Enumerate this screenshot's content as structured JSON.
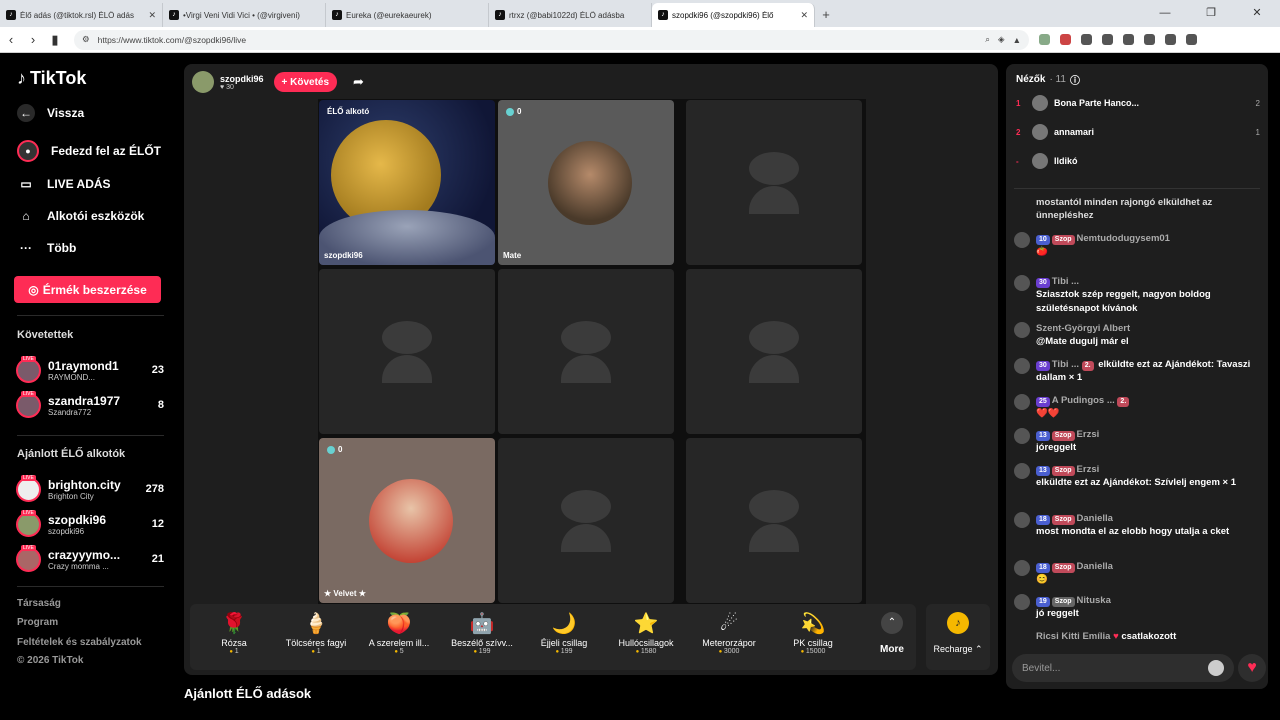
{
  "browser": {
    "tabs": [
      {
        "title": "Élő adás (@tiktok.rsl) ÉLŐ adás"
      },
      {
        "title": "•Virgi Veni Vidi Vici • (@virgiveni)"
      },
      {
        "title": "Eureka (@eurekaeurek)"
      },
      {
        "title": "rtrxz (@babi1022d) ÉLŐ adásba"
      },
      {
        "title": "szopdki96 (@szopdki96) Élő"
      }
    ],
    "url": "https://www.tiktok.com/@szopdki96/live"
  },
  "sidebar": {
    "logo": "TikTok",
    "nav": [
      {
        "label": "Vissza"
      },
      {
        "label": "Fedezd fel az ÉLŐT"
      },
      {
        "label": "LIVE ADÁS"
      },
      {
        "label": "Alkotói eszközök"
      },
      {
        "label": "Több"
      }
    ],
    "coin_button": "Érmék beszerzése",
    "following_title": "Követettek",
    "following": [
      {
        "name": "01raymond1",
        "sub": "RAYMOND...",
        "count": "23"
      },
      {
        "name": "szandra1977",
        "sub": "Szandra772",
        "count": "8"
      }
    ],
    "recommended_title": "Ajánlott ÉLŐ alkotók",
    "recommended": [
      {
        "name": "brighton.city",
        "sub": "Brighton City",
        "count": "278"
      },
      {
        "name": "szopdki96",
        "sub": "szopdki96",
        "count": "12"
      },
      {
        "name": "crazyyymo...",
        "sub": "Crazy momma ...",
        "count": "21"
      }
    ],
    "footer": [
      "Társaság",
      "Program",
      "Feltételek és szabályzatok",
      "© 2026 TikTok"
    ]
  },
  "stream": {
    "host": "szopdki96",
    "likes": "30",
    "follow": "+ Követés",
    "cells": [
      {
        "top": "ÉLŐ alkotó",
        "label": "szopdki96"
      },
      {
        "top": "0",
        "label": "Mate"
      },
      {
        "top": "0",
        "label": "★ Velvet ★"
      }
    ],
    "gifts": [
      {
        "name": "Rózsa",
        "price": "1",
        "icon": "🌹"
      },
      {
        "name": "Tölcséres fagyi",
        "price": "1",
        "icon": "🍦"
      },
      {
        "name": "A szerelem ill...",
        "price": "5",
        "icon": "🍑"
      },
      {
        "name": "Beszélő szívv...",
        "price": "199",
        "icon": "🤖"
      },
      {
        "name": "Éjjeli csillag",
        "price": "199",
        "icon": "🌙"
      },
      {
        "name": "Hullócsillagok",
        "price": "1580",
        "icon": "⭐"
      },
      {
        "name": "Meterorzápor",
        "price": "3000",
        "icon": "☄"
      },
      {
        "name": "PK csillag",
        "price": "15000",
        "icon": "💫"
      }
    ],
    "more": "More",
    "recharge": "Recharge",
    "below_title": "Ajánlott ÉLŐ adások"
  },
  "chat": {
    "title": "Nézők",
    "viewers_count": "· 11",
    "viewers": [
      {
        "rank": "1",
        "name": "Bona Parte Hanco...",
        "score": "2"
      },
      {
        "rank": "2",
        "name": "annamari",
        "score": "1"
      },
      {
        "rank": "-",
        "name": "Ildikó",
        "score": ""
      }
    ],
    "messages": [
      {
        "user": "",
        "text": "mostantól minden rajongó elküldhet az ünnepléshez",
        "lvl": "",
        "sz": ""
      },
      {
        "user": "Nemtudodugysem01",
        "text": "🍅",
        "lvl": "10",
        "sz": "Szop"
      },
      {
        "user": "Tibi ...",
        "text": "Sziasztok szép reggelt, nagyon boldog születésnapot kívánok",
        "lvl": "30",
        "sz": ""
      },
      {
        "user": "Szent-Györgyi Albert",
        "text": "@Mate dugulj már el",
        "lvl": "",
        "sz": ""
      },
      {
        "user": "Tibi ...",
        "text": "elküldte ezt az Ajándékot: Tavaszi dallam × 1",
        "lvl": "30",
        "sz": "2."
      },
      {
        "user": "A Pudingos ...",
        "text": "❤️❤️",
        "lvl": "25",
        "sz": "2."
      },
      {
        "user": "Erzsi",
        "text": "jóreggelt",
        "lvl": "13",
        "sz": "Szop"
      },
      {
        "user": "Erzsi",
        "text": "elküldte ezt az Ajándékot: Szívlelj engem × 1",
        "lvl": "13",
        "sz": "Szop"
      },
      {
        "user": "Daniella",
        "text": "most mondta el az elobb hogy utalja a cket",
        "lvl": "18",
        "sz": "Szop"
      },
      {
        "user": "Daniella",
        "text": "😊",
        "lvl": "18",
        "sz": "Szop"
      },
      {
        "user": "Nituska",
        "text": "jó reggelt",
        "lvl": "19",
        "sz": "Szop"
      },
      {
        "user": "Ricsi Kitti Emília",
        "text": "csatlakozott",
        "lvl": "",
        "sz": ""
      }
    ],
    "input_placeholder": "Bevitel..."
  }
}
